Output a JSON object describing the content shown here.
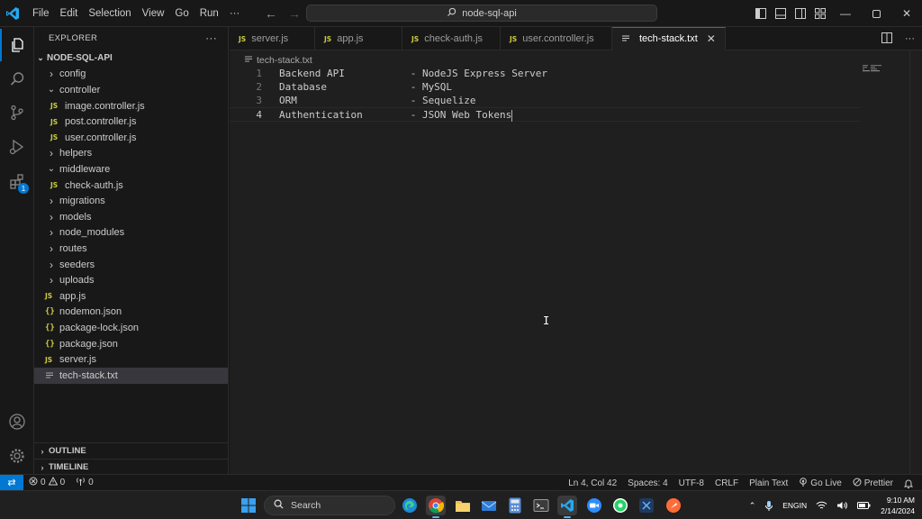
{
  "titlebar": {
    "menu": [
      "File",
      "Edit",
      "Selection",
      "View",
      "Go",
      "Run"
    ],
    "command_center": "node-sql-api"
  },
  "explorer": {
    "header": "EXPLORER",
    "root": "NODE-SQL-API",
    "items": [
      {
        "label": "config",
        "kind": "folder",
        "expanded": false,
        "depth": 1
      },
      {
        "label": "controller",
        "kind": "folder",
        "expanded": true,
        "depth": 1
      },
      {
        "label": "image.controller.js",
        "kind": "js",
        "depth": 2
      },
      {
        "label": "post.controller.js",
        "kind": "js",
        "depth": 2
      },
      {
        "label": "user.controller.js",
        "kind": "js",
        "depth": 2
      },
      {
        "label": "helpers",
        "kind": "folder",
        "expanded": false,
        "depth": 1
      },
      {
        "label": "middleware",
        "kind": "folder",
        "expanded": true,
        "depth": 1
      },
      {
        "label": "check-auth.js",
        "kind": "js",
        "depth": 2
      },
      {
        "label": "migrations",
        "kind": "folder",
        "expanded": false,
        "depth": 1
      },
      {
        "label": "models",
        "kind": "folder",
        "expanded": false,
        "depth": 1
      },
      {
        "label": "node_modules",
        "kind": "folder",
        "expanded": false,
        "depth": 1
      },
      {
        "label": "routes",
        "kind": "folder",
        "expanded": false,
        "depth": 1
      },
      {
        "label": "seeders",
        "kind": "folder",
        "expanded": false,
        "depth": 1
      },
      {
        "label": "uploads",
        "kind": "folder",
        "expanded": false,
        "depth": 1
      },
      {
        "label": "app.js",
        "kind": "js",
        "depth": 1
      },
      {
        "label": "nodemon.json",
        "kind": "json",
        "depth": 1
      },
      {
        "label": "package-lock.json",
        "kind": "json",
        "depth": 1
      },
      {
        "label": "package.json",
        "kind": "json",
        "depth": 1
      },
      {
        "label": "server.js",
        "kind": "js",
        "depth": 1
      },
      {
        "label": "tech-stack.txt",
        "kind": "txt",
        "depth": 1,
        "selected": true
      }
    ],
    "outline": "OUTLINE",
    "timeline": "TIMELINE"
  },
  "activity": {
    "extensions_badge": "1"
  },
  "tabs": [
    {
      "label": "server.js",
      "kind": "js",
      "active": false
    },
    {
      "label": "app.js",
      "kind": "js",
      "active": false
    },
    {
      "label": "check-auth.js",
      "kind": "js",
      "active": false
    },
    {
      "label": "user.controller.js",
      "kind": "js",
      "active": false
    },
    {
      "label": "tech-stack.txt",
      "kind": "txt",
      "active": true
    }
  ],
  "editor": {
    "breadcrumb": "tech-stack.txt",
    "lines": [
      {
        "num": "1",
        "text": "Backend API           - NodeJS Express Server"
      },
      {
        "num": "2",
        "text": "Database              - MySQL"
      },
      {
        "num": "3",
        "text": "ORM                   - Sequelize"
      },
      {
        "num": "4",
        "text": "Authentication        - JSON Web Tokens",
        "current": true
      }
    ]
  },
  "statusbar": {
    "errors": "0",
    "warnings": "0",
    "ports": "0",
    "position": "Ln 4, Col 42",
    "spaces": "Spaces: 4",
    "encoding": "UTF-8",
    "eol": "CRLF",
    "language": "Plain Text",
    "golive": "Go Live",
    "prettier": "Prettier"
  },
  "taskbar": {
    "search": "Search",
    "lang1": "ENG",
    "lang2": "IN",
    "time": "9:10 AM",
    "date": "2/14/2024"
  },
  "colors": {
    "accent": "#0078d4",
    "js_icon": "#cbcb41"
  }
}
